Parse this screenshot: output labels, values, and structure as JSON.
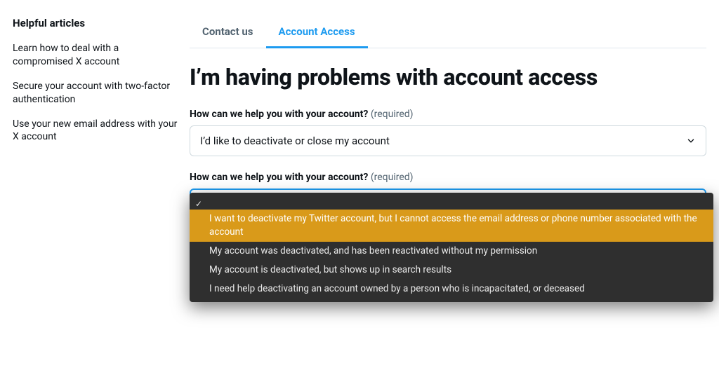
{
  "sidebar": {
    "title": "Helpful articles",
    "links": [
      "Learn how to deal with a compromised X account",
      "Secure your account with two-factor authentication",
      "Use your new email address with your X account"
    ]
  },
  "tabs": {
    "contact": "Contact us",
    "account_access": "Account Access"
  },
  "page_title": "I’m having problems with account access",
  "field1": {
    "label": "How can we help you with your account?",
    "required": "(required)",
    "value": "I’d like to deactivate or close my account"
  },
  "field2": {
    "label": "How can we help you with your account?",
    "required": "(required)",
    "options": [
      "",
      "I want to deactivate my Twitter account, but I cannot access the email address or phone number associated with the account",
      "My account was deactivated, and has been reactivated without my permission",
      "My account is deactivated, but shows up in search results",
      "I need help deactivating an account owned by a person who is incapacitated, or deceased"
    ],
    "selected_index": 0,
    "highlight_index": 1
  }
}
